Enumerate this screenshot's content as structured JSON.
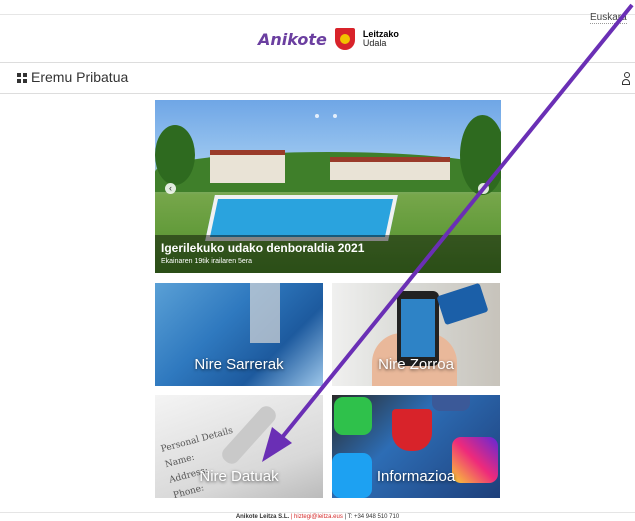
{
  "header": {
    "language": "Euskara",
    "logo_brand": "Anikote",
    "municipality_line1": "Leitzako",
    "municipality_line2": "Udala"
  },
  "navbar": {
    "title": "Eremu Pribatua"
  },
  "slider": {
    "title": "Igerilekuko udako denboraldia 2021",
    "subtitle": "Ekainaren 19tik irailaren 5era",
    "prev": "‹",
    "next": "›"
  },
  "tiles": {
    "sarrerak": "Nire Sarrerak",
    "zorroa": "Nire Zorroa",
    "datuak": "Nire Datuak",
    "informazioa": "Informazioa"
  },
  "tile_decor": {
    "personal": "Personal Details",
    "name": "Name:",
    "address": "Address:",
    "phone": "Phone:"
  },
  "footer": {
    "company": "Anikote Leitza S.L.",
    "email": "| hiztegi@leitza.eus",
    "phone": "| T: +34 948 510 710"
  },
  "annotation": {
    "arrow_color": "#6a2fb5"
  }
}
